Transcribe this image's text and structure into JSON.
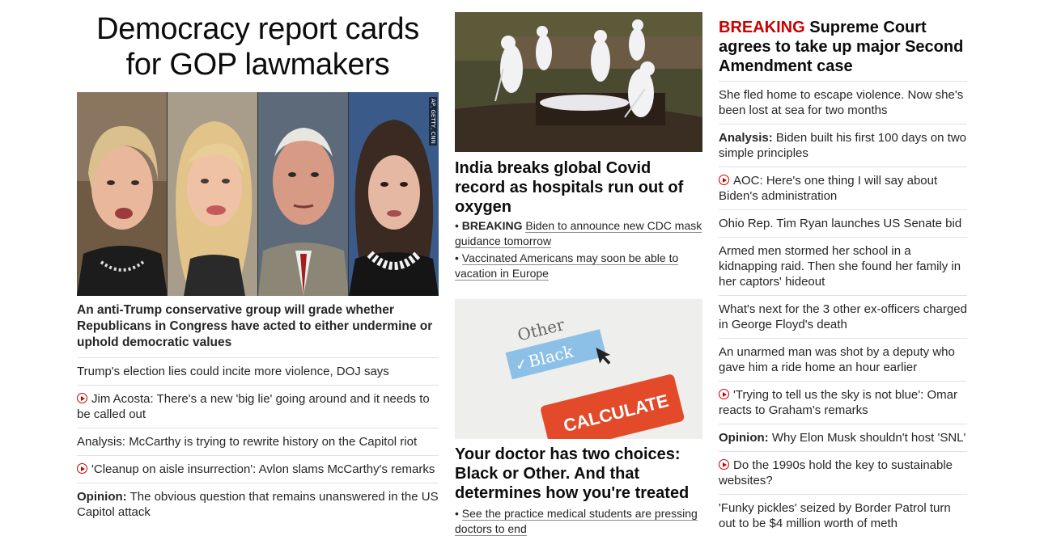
{
  "col1": {
    "headline": "Democracy report cards for GOP lawmakers",
    "photo_credit": "AP, GETTY, CNN",
    "sub": "An anti-Trump conservative group will grade whether Republicans in Congress have acted to either undermine or uphold democratic values",
    "items": [
      {
        "prefix": "",
        "text": "Trump's election lies could incite more violence, DOJ says",
        "video": false
      },
      {
        "prefix": "",
        "text": "Jim Acosta: There's a new 'big lie' going around and it needs to be called out",
        "video": true
      },
      {
        "prefix": "",
        "text": "Analysis: McCarthy is trying to rewrite history on the Capitol riot",
        "video": false
      },
      {
        "prefix": "",
        "text": "'Cleanup on aisle insurrection': Avlon slams McCarthy's remarks",
        "video": true
      },
      {
        "prefix": "Opinion:",
        "text": "The obvious question that remains unanswered in the US Capitol attack",
        "video": false
      }
    ]
  },
  "col2": {
    "story1": {
      "title": "India breaks global Covid record as hospitals run out of oxygen",
      "b1_label": "BREAKING",
      "b1_text": "Biden to announce new CDC mask guidance tomorrow",
      "b2_text": "Vaccinated Americans may soon be able to vacation in Europe"
    },
    "story2": {
      "img_other": "Other",
      "img_black": "Black",
      "img_calc": "CALCULATE",
      "title": "Your doctor has two choices: Black or Other. And that determines how you're treated",
      "b1_text": "See the practice medical students are pressing doctors to end"
    }
  },
  "col3": {
    "breaking_label": "BREAKING",
    "breaking_text": "Supreme Court agrees to take up major Second Amendment case",
    "items": [
      {
        "prefix": "",
        "text": "She fled home to escape violence. Now she's been lost at sea for two months",
        "video": false
      },
      {
        "prefix": "Analysis:",
        "text": "Biden built his first 100 days on two simple principles",
        "video": false
      },
      {
        "prefix": "",
        "text": "AOC: Here's one thing I will say about Biden's administration",
        "video": true
      },
      {
        "prefix": "",
        "text": "Ohio Rep. Tim Ryan launches US Senate bid",
        "video": false
      },
      {
        "prefix": "",
        "text": "Armed men stormed her school in a kidnapping raid. Then she found her family in her captors' hideout",
        "video": false
      },
      {
        "prefix": "",
        "text": "What's next for the 3 other ex-officers charged in George Floyd's death",
        "video": false
      },
      {
        "prefix": "",
        "text": "An unarmed man was shot by a deputy who gave him a ride home an hour earlier",
        "video": false
      },
      {
        "prefix": "",
        "text": "'Trying to tell us the sky is not blue': Omar reacts to Graham's remarks",
        "video": true
      },
      {
        "prefix": "Opinion:",
        "text": "Why Elon Musk shouldn't host 'SNL'",
        "video": false
      },
      {
        "prefix": "",
        "text": "Do the 1990s hold the key to sustainable websites?",
        "video": true
      },
      {
        "prefix": "",
        "text": "'Funky pickles' seized by Border Patrol turn out to be $4 million worth of meth",
        "video": false
      }
    ]
  },
  "colors": {
    "accent_red": "#cc0000",
    "divider": "#e1e1e1",
    "text": "#262626"
  }
}
